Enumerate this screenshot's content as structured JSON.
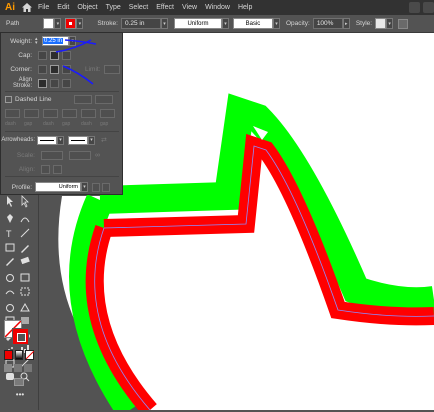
{
  "menubar": {
    "logo": "Ai",
    "items": [
      "File",
      "Edit",
      "Object",
      "Type",
      "Select",
      "Effect",
      "View",
      "Window",
      "Help"
    ]
  },
  "controlbar": {
    "selection_label": "Path",
    "stroke_label": "Stroke:",
    "stroke_value": "0.25 in",
    "profile_value": "Uniform",
    "brush_value": "Basic",
    "opacity_label": "Opacity:",
    "opacity_value": "100%",
    "style_label": "Style:"
  },
  "stroke_panel": {
    "weight_label": "Weight:",
    "weight_value": "0.25 in",
    "cap_label": "Cap:",
    "corner_label": "Corner:",
    "limit_label": "Limit:",
    "limit_value": "10",
    "align_label": "Align Stroke:",
    "dashed_label": "Dashed Line",
    "dash_labels": [
      "dash",
      "gap",
      "dash",
      "gap",
      "dash",
      "gap"
    ],
    "arrowheads_label": "Arrowheads:",
    "scale_label": "Scale:",
    "scale_value_1": "100%",
    "scale_value_2": "100%",
    "align_label2": "Align:",
    "profile_label": "Profile:",
    "profile_value": "Uniform"
  },
  "colors": {
    "menubar_bg": "#323232",
    "ui_bg": "#535353",
    "artboard": "#ffffff",
    "outer_stroke": "#00ff00",
    "inner_stroke": "#ff0000",
    "annotation": "#1a1aff"
  },
  "icons": {
    "home": "home-icon",
    "selection": "selection-tool-icon",
    "direct_selection": "direct-selection-tool-icon"
  }
}
